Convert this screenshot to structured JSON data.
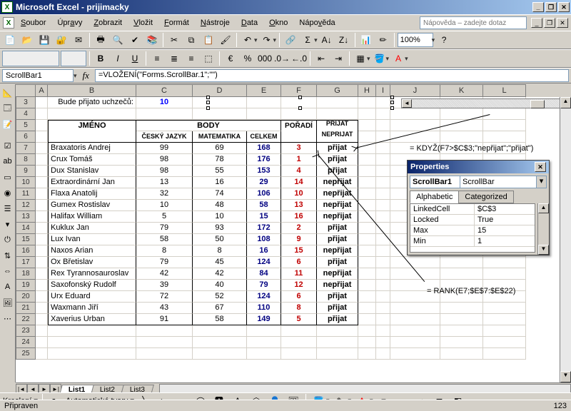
{
  "window": {
    "title": "Microsoft Excel - prijimacky"
  },
  "menu": [
    "Soubor",
    "Úpravy",
    "Zobrazit",
    "Vložit",
    "Formát",
    "Nástroje",
    "Data",
    "Okno",
    "Nápověda"
  ],
  "help_placeholder": "Nápověda – zadejte dotaz",
  "toolbar": {
    "zoom": "100%"
  },
  "namebox": "ScrollBar1",
  "formula": "=VLOŽENÍ(\"Forms.ScrollBar.1\";\"\")",
  "columns": [
    "A",
    "B",
    "C",
    "D",
    "E",
    "F",
    "G",
    "H",
    "I",
    "J",
    "K",
    "L"
  ],
  "rows_visible_start": 3,
  "rows_visible_end": 25,
  "row3": {
    "label": "Bude přijato uchzečů:",
    "value": "10"
  },
  "headers": {
    "jmeno": "JMÉNO",
    "body": "BODY",
    "cesky": "ČESKÝ JAZYK",
    "matematika": "MATEMATIKA",
    "celkem": "CELKEM",
    "poradi": "POŘADÍ",
    "prijat": "PŘIJAT NEPŘIJAT"
  },
  "table": [
    {
      "name": "Braxatoris Andrej",
      "cz": 99,
      "math": 69,
      "sum": 168,
      "rank": 3,
      "res": "přijat"
    },
    {
      "name": "Crux Tomáš",
      "cz": 98,
      "math": 78,
      "sum": 176,
      "rank": 1,
      "res": "přijat"
    },
    {
      "name": "Dux Stanislav",
      "cz": 98,
      "math": 55,
      "sum": 153,
      "rank": 4,
      "res": "přijat"
    },
    {
      "name": "Extraordinární Jan",
      "cz": 13,
      "math": 16,
      "sum": 29,
      "rank": 14,
      "res": "nepřijat"
    },
    {
      "name": "Flaxa Anatolij",
      "cz": 32,
      "math": 74,
      "sum": 106,
      "rank": 10,
      "res": "nepřijat"
    },
    {
      "name": "Gumex Rostislav",
      "cz": 10,
      "math": 48,
      "sum": 58,
      "rank": 13,
      "res": "nepřijat"
    },
    {
      "name": "Halifax William",
      "cz": 5,
      "math": 10,
      "sum": 15,
      "rank": 16,
      "res": "nepřijat"
    },
    {
      "name": "Kuklux Jan",
      "cz": 79,
      "math": 93,
      "sum": 172,
      "rank": 2,
      "res": "přijat"
    },
    {
      "name": "Lux Ivan",
      "cz": 58,
      "math": 50,
      "sum": 108,
      "rank": 9,
      "res": "přijat"
    },
    {
      "name": "Naxos Arian",
      "cz": 8,
      "math": 8,
      "sum": 16,
      "rank": 15,
      "res": "nepřijat"
    },
    {
      "name": "Ox Břetislav",
      "cz": 79,
      "math": 45,
      "sum": 124,
      "rank": 6,
      "res": "přijat"
    },
    {
      "name": "Rex Tyrannosauroslav",
      "cz": 42,
      "math": 42,
      "sum": 84,
      "rank": 11,
      "res": "nepřijat"
    },
    {
      "name": "Saxofonský Rudolf",
      "cz": 39,
      "math": 40,
      "sum": 79,
      "rank": 12,
      "res": "nepřijat"
    },
    {
      "name": "Urx Eduard",
      "cz": 72,
      "math": 52,
      "sum": 124,
      "rank": 6,
      "res": "přijat"
    },
    {
      "name": "Waxmann Jiří",
      "cz": 43,
      "math": 67,
      "sum": 110,
      "rank": 8,
      "res": "přijat"
    },
    {
      "name": "Xaverius Urban",
      "cz": 91,
      "math": 58,
      "sum": 149,
      "rank": 5,
      "res": "přijat"
    }
  ],
  "annotation1": "= KDYŽ(F7>$C$3;\"nepřijat\";\"přijat\")",
  "annotation2": "= RANK(E7;$E$7:$E$22)",
  "properties": {
    "title": "Properties",
    "object_name": "ScrollBar1",
    "object_type": "ScrollBar",
    "tabs": [
      "Alphabetic",
      "Categorized"
    ],
    "rows": [
      {
        "k": "LinkedCell",
        "v": "$C$3"
      },
      {
        "k": "Locked",
        "v": "True"
      },
      {
        "k": "Max",
        "v": "15"
      },
      {
        "k": "Min",
        "v": "1"
      }
    ]
  },
  "sheets": [
    "List1",
    "List2",
    "List3"
  ],
  "drawbar": {
    "kresleni": "Kreslení",
    "tvary": "Automatické tvary"
  },
  "status": {
    "left": "Připraven",
    "right": "123"
  }
}
